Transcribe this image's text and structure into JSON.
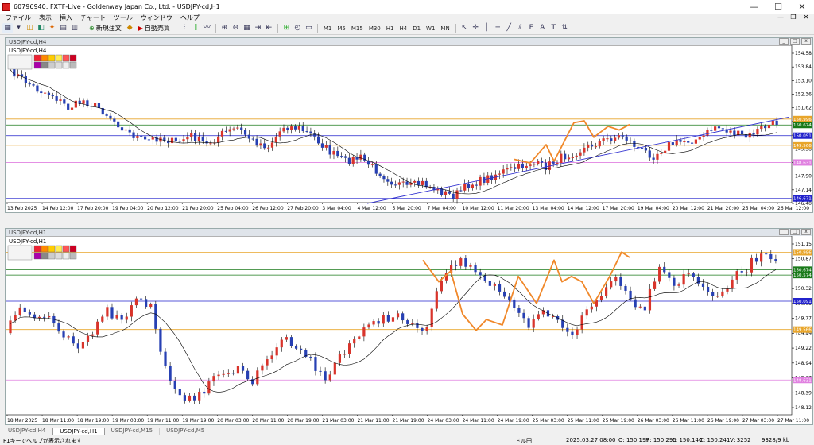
{
  "window": {
    "title": "60796940: FXTF-Live - Goldenway Japan Co., Ltd. - USDJPY-cd,H1",
    "controls": [
      "—",
      "☐",
      "✕"
    ]
  },
  "menu": [
    "ファイル",
    "表示",
    "挿入",
    "チャート",
    "ツール",
    "ウィンドウ",
    "ヘルプ"
  ],
  "toolbar": {
    "new_order": "新規注文",
    "auto_trade": "自動売買",
    "timeframes": [
      "M1",
      "M5",
      "M15",
      "M30",
      "H1",
      "H4",
      "D1",
      "W1",
      "MN"
    ]
  },
  "top_chart": {
    "title": "USDJPY-cd,H4",
    "symbol": "USDJPY-cd,H4",
    "price_ticks": [
      "154.580",
      "153.840",
      "153.100",
      "152.360",
      "151.620",
      "150.880",
      "150.140",
      "149.380",
      "148.640",
      "147.900",
      "147.140",
      "146.400"
    ],
    "price_tags": [
      {
        "text": "150.996",
        "color": "#e8a52a"
      },
      {
        "text": "150.674",
        "color": "#1a7a1a"
      },
      {
        "text": "150.091",
        "color": "#2222cc"
      },
      {
        "text": "149.566",
        "color": "#e8a52a"
      },
      {
        "text": "148.631",
        "color": "#e080e0"
      },
      {
        "text": "146.671",
        "color": "#2222cc"
      }
    ],
    "time_labels": [
      "13 Feb 2025",
      "14 Feb 12:00",
      "17 Feb 20:00",
      "19 Feb 04:00",
      "20 Feb 12:00",
      "21 Feb 20:00",
      "25 Feb 04:00",
      "26 Feb 12:00",
      "27 Feb 20:00",
      "3 Mar 04:00",
      "4 Mar 12:00",
      "5 Mar 20:00",
      "7 Mar 04:00",
      "10 Mar 12:00",
      "11 Mar 20:00",
      "13 Mar 04:00",
      "14 Mar 12:00",
      "17 Mar 20:00",
      "19 Mar 04:00",
      "20 Mar 12:00",
      "21 Mar 20:00",
      "25 Mar 04:00",
      "26 Mar 12:00"
    ]
  },
  "bottom_chart": {
    "title": "USDJPY-cd,H1",
    "symbol": "USDJPY-cd,H1",
    "price_ticks": [
      "151.150",
      "150.875",
      "150.600",
      "150.325",
      "150.050",
      "149.775",
      "149.495",
      "149.220",
      "148.945",
      "148.670",
      "148.395",
      "148.120"
    ],
    "price_tags": [
      {
        "text": "150.996",
        "color": "#e8a52a"
      },
      {
        "text": "150.674",
        "color": "#1a7a1a"
      },
      {
        "text": "150.574",
        "color": "#1a7a1a"
      },
      {
        "text": "150.091",
        "color": "#2222cc"
      },
      {
        "text": "149.566",
        "color": "#e8a52a"
      },
      {
        "text": "148.631",
        "color": "#e080e0"
      }
    ],
    "time_labels": [
      "18 Mar 2025",
      "18 Mar 11:00",
      "18 Mar 19:00",
      "19 Mar 03:00",
      "19 Mar 11:00",
      "19 Mar 19:00",
      "20 Mar 03:00",
      "20 Mar 11:00",
      "20 Mar 19:00",
      "21 Mar 03:00",
      "21 Mar 11:00",
      "21 Mar 19:00",
      "24 Mar 03:00",
      "24 Mar 11:00",
      "24 Mar 19:00",
      "25 Mar 03:00",
      "25 Mar 11:00",
      "25 Mar 19:00",
      "26 Mar 03:00",
      "26 Mar 11:00",
      "26 Mar 19:00",
      "27 Mar 03:00",
      "27 Mar 11:00"
    ]
  },
  "tabs": [
    "USDJPY-cd,H4",
    "USDJPY-cd,H1",
    "USDJPY-cd,M15",
    "USDJPY-cd,M5"
  ],
  "status": {
    "help": "F1キーでヘルプが表示されます",
    "profile": "ドル円",
    "datetime": "2025.03.27 08:00",
    "open": "O: 150.197",
    "high": "H: 150.295",
    "low": "L: 150.140",
    "close": "C: 150.241",
    "volume": "V: 3252",
    "traffic": "9328/9 kb"
  }
}
